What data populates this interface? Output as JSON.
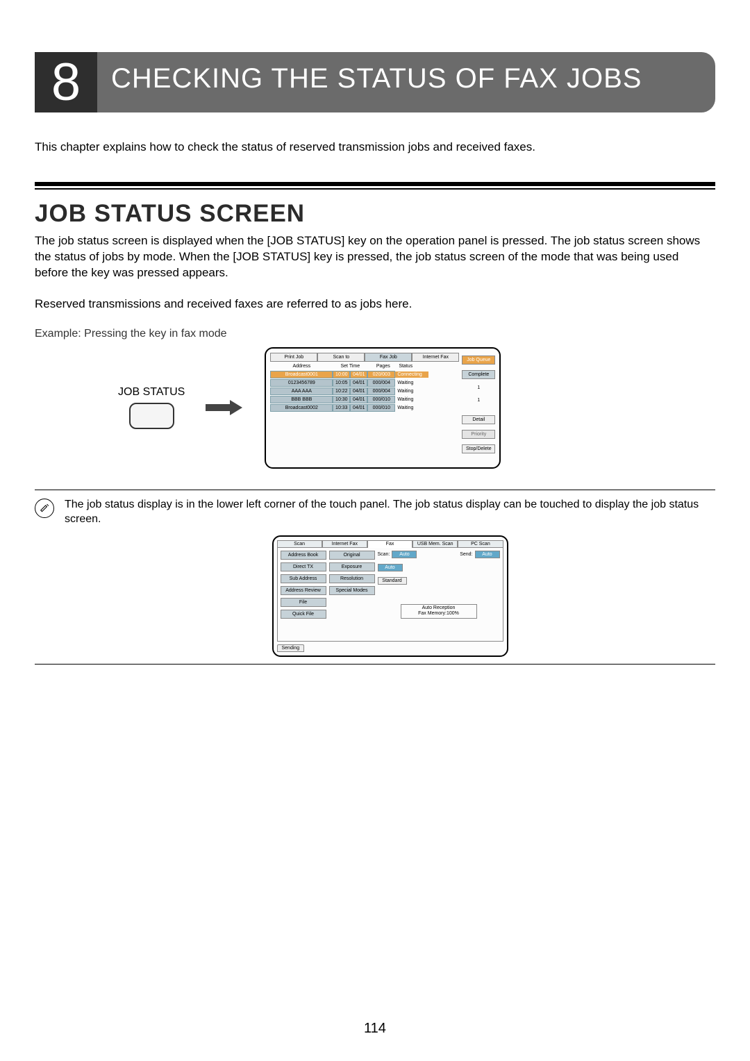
{
  "header": {
    "number": "8",
    "title": "CHECKING THE STATUS OF FAX JOBS"
  },
  "intro": "This chapter explains how to check the status of reserved transmission jobs and received faxes.",
  "section_title": "JOB STATUS SCREEN",
  "body1": "The job status screen is displayed when the [JOB STATUS] key on the operation panel is pressed. The job status screen shows the status of jobs by mode. When the [JOB STATUS] key is pressed, the job status screen of the mode that was being used before the key was pressed appears.",
  "body2": "Reserved transmissions and received faxes are referred to as jobs here.",
  "example_label": "Example: Pressing the key in fax mode",
  "key_label": "JOB STATUS",
  "screen1": {
    "tabs": [
      "Print Job",
      "Scan to",
      "Fax Job",
      "Internet Fax"
    ],
    "headers": {
      "address": "Address",
      "settime": "Set Time",
      "pages": "Pages",
      "status": "Status"
    },
    "rows": [
      {
        "addr": "Broadcast0001",
        "time": "10:00",
        "date": "04/01",
        "pages": "020/003",
        "status": "Connecting"
      },
      {
        "addr": "0123456789",
        "time": "10:05",
        "date": "04/01",
        "pages": "000/004",
        "status": "Waiting"
      },
      {
        "addr": "AAA AAA",
        "time": "10:22",
        "date": "04/01",
        "pages": "000/004",
        "status": "Waiting"
      },
      {
        "addr": "BBB BBB",
        "time": "10:30",
        "date": "04/01",
        "pages": "000/010",
        "status": "Waiting"
      },
      {
        "addr": "Broadcast0002",
        "time": "10:33",
        "date": "04/01",
        "pages": "000/010",
        "status": "Waiting"
      }
    ],
    "side": {
      "jobqueue": "Job Queue",
      "complete": "Complete",
      "detail": "Detail",
      "priority": "Priority",
      "stopdelete": "Stop/Delete"
    },
    "page_top": "1",
    "page_bottom": "1"
  },
  "note_text": "The job status display is in the lower left corner of the touch panel. The job status display can be touched to display the job status screen.",
  "screen2": {
    "tabs": [
      "Scan",
      "Internet Fax",
      "Fax",
      "USB Mem. Scan",
      "PC Scan"
    ],
    "col1": [
      "Address Book",
      "Direct TX",
      "Sub Address",
      "Address Review",
      "File",
      "Quick File"
    ],
    "col2": [
      "Original",
      "Exposure",
      "Resolution",
      "Special Modes"
    ],
    "rows": {
      "scan_label": "Scan:",
      "scan_val": "Auto",
      "send_label": "Send:",
      "send_val": "Auto",
      "r2_val": "Auto",
      "r3_val": "Standard"
    },
    "info1": "Auto Reception",
    "info2": "Fax Memory:100%",
    "sending": "Sending"
  },
  "page_number": "114"
}
